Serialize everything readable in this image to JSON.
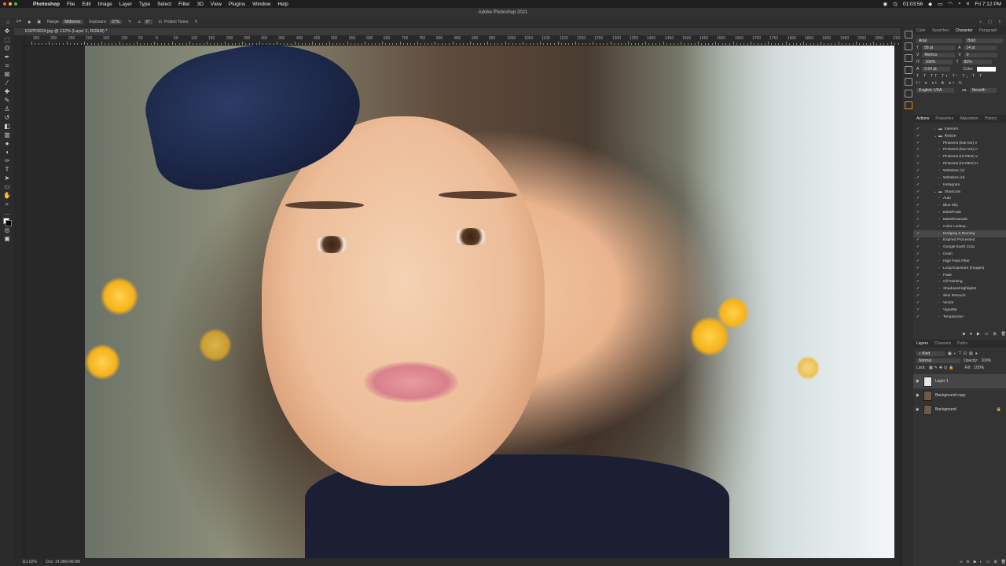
{
  "menubar": {
    "app": "Photoshop",
    "menus": [
      "File",
      "Edit",
      "Image",
      "Layer",
      "Type",
      "Select",
      "Filter",
      "3D",
      "View",
      "Plugins",
      "Window",
      "Help"
    ],
    "clock": "01:03:56",
    "datetime": "Fri 7:12 PM"
  },
  "window_title": "Adobe Photoshop 2021",
  "options": {
    "range_label": "Range:",
    "range_value": "Midtones",
    "exposure_label": "Exposure:",
    "exposure_value": "37%",
    "angle_value": "0°",
    "protect_tones": "Protect Tones"
  },
  "document_tab": "ESPF0624.jpg @ 112% (Layer 1, RGB/8) *",
  "ruler_labels": [
    "350",
    "300",
    "250",
    "200",
    "150",
    "100",
    "50",
    "0",
    "50",
    "100",
    "150",
    "200",
    "250",
    "300",
    "350",
    "400",
    "450",
    "500",
    "550",
    "600",
    "650",
    "700",
    "750",
    "800",
    "850",
    "900",
    "950",
    "1000",
    "1050",
    "1100",
    "1150",
    "1200",
    "1250",
    "1300",
    "1350",
    "1400",
    "1450",
    "1500",
    "1550",
    "1600",
    "1650",
    "1700",
    "1750",
    "1800",
    "1850",
    "1900",
    "1950",
    "2000",
    "2050",
    "2100"
  ],
  "status": {
    "zoom": "111.62%",
    "doc": "Doc: 14.3M/148.8M"
  },
  "char_panel": {
    "tabs": [
      "Color",
      "Swatches",
      "Character",
      "Paragraph"
    ],
    "font": "Arial",
    "style": "Bold",
    "size": "58 pt",
    "leading": "14 pt",
    "kerning": "Metrics",
    "tracking": "0",
    "vscale": "100%",
    "hscale": "83%",
    "baseline": "0.04 pt",
    "color_label": "Color:",
    "language": "English: USA",
    "aa_label": "aa",
    "aa_value": "Smooth"
  },
  "actions_panel": {
    "tabs": [
      "Actions",
      "Properties",
      "Adjustmen",
      "History"
    ],
    "items": [
      {
        "name": "Interiors",
        "folder": true,
        "indent": 1
      },
      {
        "name": "Resize",
        "folder": true,
        "indent": 1,
        "open": true
      },
      {
        "name": "Pinterest (low-res) V",
        "indent": 2
      },
      {
        "name": "Pinterest (low-res) H",
        "indent": 2
      },
      {
        "name": "Pinterest (HI-RES) V",
        "indent": 2
      },
      {
        "name": "Pinterest (HI-RES) H",
        "indent": 2
      },
      {
        "name": "Websites (V)",
        "indent": 2
      },
      {
        "name": "Websites (H)",
        "indent": 2
      },
      {
        "name": "Instagram",
        "indent": 2
      },
      {
        "name": "Shortcuts",
        "folder": true,
        "indent": 1,
        "open": true
      },
      {
        "name": "Auto",
        "indent": 2
      },
      {
        "name": "Blue Sky",
        "indent": 2
      },
      {
        "name": "B&W/Fade",
        "indent": 2
      },
      {
        "name": "B&W/Dramatic",
        "indent": 2
      },
      {
        "name": "Color Lookup...",
        "indent": 2
      },
      {
        "name": "Dodging & Burning",
        "indent": 2,
        "highlight": true
      },
      {
        "name": "Expired Processed",
        "indent": 2
      },
      {
        "name": "Google Earth Crop",
        "indent": 2
      },
      {
        "name": "Grain",
        "indent": 2
      },
      {
        "name": "High Pass Filter",
        "indent": 2
      },
      {
        "name": "Long Exposure (images)",
        "indent": 2
      },
      {
        "name": "Fade",
        "indent": 2
      },
      {
        "name": "Oil Painting",
        "indent": 2
      },
      {
        "name": "Shadows/Highlights",
        "indent": 2
      },
      {
        "name": "Skin Retouch",
        "indent": 2
      },
      {
        "name": "Vector",
        "indent": 2
      },
      {
        "name": "Vignette",
        "indent": 2
      },
      {
        "name": "Temptaction",
        "indent": 2
      }
    ]
  },
  "layers_panel": {
    "tabs": [
      "Layers",
      "Channels",
      "Paths"
    ],
    "kind": "Kind",
    "blend": "Normal",
    "opacity_label": "Opacity:",
    "opacity": "100%",
    "lock_label": "Lock:",
    "fill_label": "Fill:",
    "fill": "100%",
    "layers": [
      {
        "name": "Layer 1",
        "selected": true,
        "thumb": "white"
      },
      {
        "name": "Background copy",
        "selected": false,
        "thumb": "photo"
      },
      {
        "name": "Background",
        "selected": false,
        "thumb": "photo",
        "locked": true
      }
    ]
  },
  "colors": {
    "accent": "#1473e6",
    "menubar": "#1e1e1e",
    "panel": "#333333"
  }
}
